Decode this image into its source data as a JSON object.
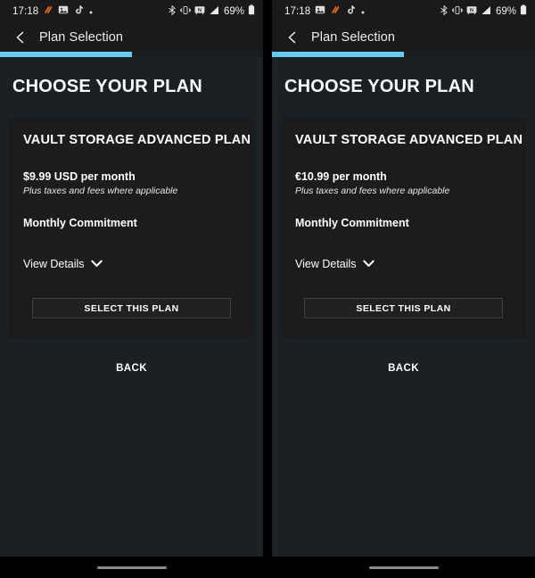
{
  "panels": [
    {
      "status_bar": {
        "time": "17:18",
        "icons": [
          "flame-orange-icon",
          "photo-icon",
          "tiktok-note-icon",
          "dot-icon"
        ],
        "right_icons": [
          "bluetooth-icon",
          "vibrate-icon",
          "nfc-icon",
          "signal-bars-icon"
        ],
        "battery_text": "69%",
        "battery_icon": "battery-icon"
      },
      "app_bar": {
        "back_icon": "back-chevron-icon",
        "title": "Plan Selection"
      },
      "progress": {
        "percent": 50
      },
      "page_title": "CHOOSE YOUR PLAN",
      "card": {
        "plan_name": "VAULT STORAGE ADVANCED PLAN",
        "price": "$9.99 USD per month",
        "taxes_note": "Plus taxes and fees where applicable",
        "commitment": "Monthly Commitment",
        "view_details_label": "View Details",
        "view_details_icon": "chevron-down-icon",
        "select_button": "SELECT THIS PLAN"
      },
      "back_button": "BACK"
    },
    {
      "status_bar": {
        "time": "17:18",
        "icons": [
          "photo-icon",
          "flame-orange-icon",
          "tiktok-note-icon",
          "dot-icon"
        ],
        "right_icons": [
          "bluetooth-icon",
          "vibrate-icon",
          "nfc-icon",
          "signal-bars-icon"
        ],
        "battery_text": "69%",
        "battery_icon": "battery-icon"
      },
      "app_bar": {
        "back_icon": "back-chevron-icon",
        "title": "Plan Selection"
      },
      "progress": {
        "percent": 50
      },
      "page_title": "CHOOSE YOUR PLAN",
      "card": {
        "plan_name": "VAULT STORAGE ADVANCED PLAN",
        "price": "€10.99 per month",
        "taxes_note": "Plus taxes and fees where applicable",
        "commitment": "Monthly Commitment",
        "view_details_label": "View Details",
        "view_details_icon": "chevron-down-icon",
        "select_button": "SELECT THIS PLAN"
      },
      "back_button": "BACK"
    }
  ],
  "colors": {
    "progress_accent": "#66cdf2",
    "page_background": "#1b2025",
    "card_background": "#1c1c1c",
    "bar_background": "#1a1a1a",
    "orange_icon": "#ef6c23"
  }
}
